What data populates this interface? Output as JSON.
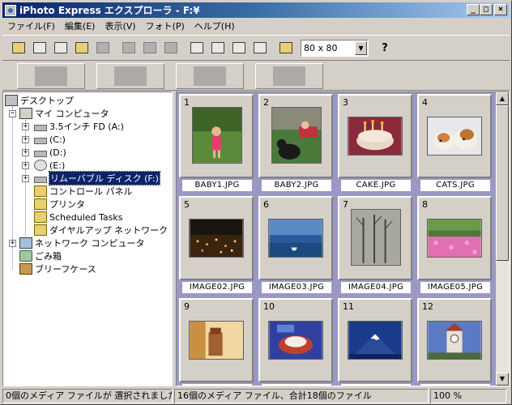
{
  "window": {
    "title": "iPhoto Express エクスプローラ - F:¥",
    "minimize": "_",
    "maximize": "□",
    "close": "×"
  },
  "menu": [
    {
      "label": "ファイル(F)"
    },
    {
      "label": "編集(E)"
    },
    {
      "label": "表示(V)"
    },
    {
      "label": "フォト(P)"
    },
    {
      "label": "ヘルプ(H)"
    }
  ],
  "toolbar": {
    "zoom_value": "80 x 80",
    "help_label": "?"
  },
  "tree": [
    {
      "label": "デスクトップ",
      "icon": "desktop-icon"
    },
    {
      "label": "マイ コンピュータ",
      "icon": "computer-icon"
    },
    {
      "label": "3.5インチ FD (A:)",
      "icon": "floppy-drive-icon"
    },
    {
      "label": "(C:)",
      "icon": "hard-drive-icon"
    },
    {
      "label": "(D:)",
      "icon": "hard-drive-icon"
    },
    {
      "label": "(E:)",
      "icon": "cd-drive-icon"
    },
    {
      "label": "リムーバブル ディスク (F:)",
      "icon": "removable-disk-icon"
    },
    {
      "label": "コントロール パネル",
      "icon": "control-panel-icon"
    },
    {
      "label": "プリンタ",
      "icon": "printer-folder-icon"
    },
    {
      "label": "Scheduled Tasks",
      "icon": "scheduled-tasks-icon"
    },
    {
      "label": "ダイヤルアップ ネットワーク",
      "icon": "dialup-network-icon"
    },
    {
      "label": "ネットワーク コンピュータ",
      "icon": "network-icon"
    },
    {
      "label": "ごみ箱",
      "icon": "recycle-bin-icon"
    },
    {
      "label": "ブリーフケース",
      "icon": "briefcase-icon"
    }
  ],
  "thumbnails": [
    {
      "num": "1",
      "file": "BABY1.JPG"
    },
    {
      "num": "2",
      "file": "BABY2.JPG"
    },
    {
      "num": "3",
      "file": "CAKE.JPG"
    },
    {
      "num": "4",
      "file": "CATS.JPG"
    },
    {
      "num": "5",
      "file": "IMAGE02.JPG"
    },
    {
      "num": "6",
      "file": "IMAGE03.JPG"
    },
    {
      "num": "7",
      "file": "IMAGE04.JPG"
    },
    {
      "num": "8",
      "file": "IMAGE05.JPG"
    },
    {
      "num": "9",
      "file": ""
    },
    {
      "num": "10",
      "file": ""
    },
    {
      "num": "11",
      "file": ""
    },
    {
      "num": "12",
      "file": ""
    }
  ],
  "status": {
    "selected": "0個のメディア ファイルが 選択されました",
    "summary": "16個のメディア ファイル、合計18個のファイル",
    "zoom": "100 %"
  },
  "colors": {
    "title_start": "#0a246a",
    "thumb_background": "#9a98c4",
    "selection": "#0a246a"
  }
}
